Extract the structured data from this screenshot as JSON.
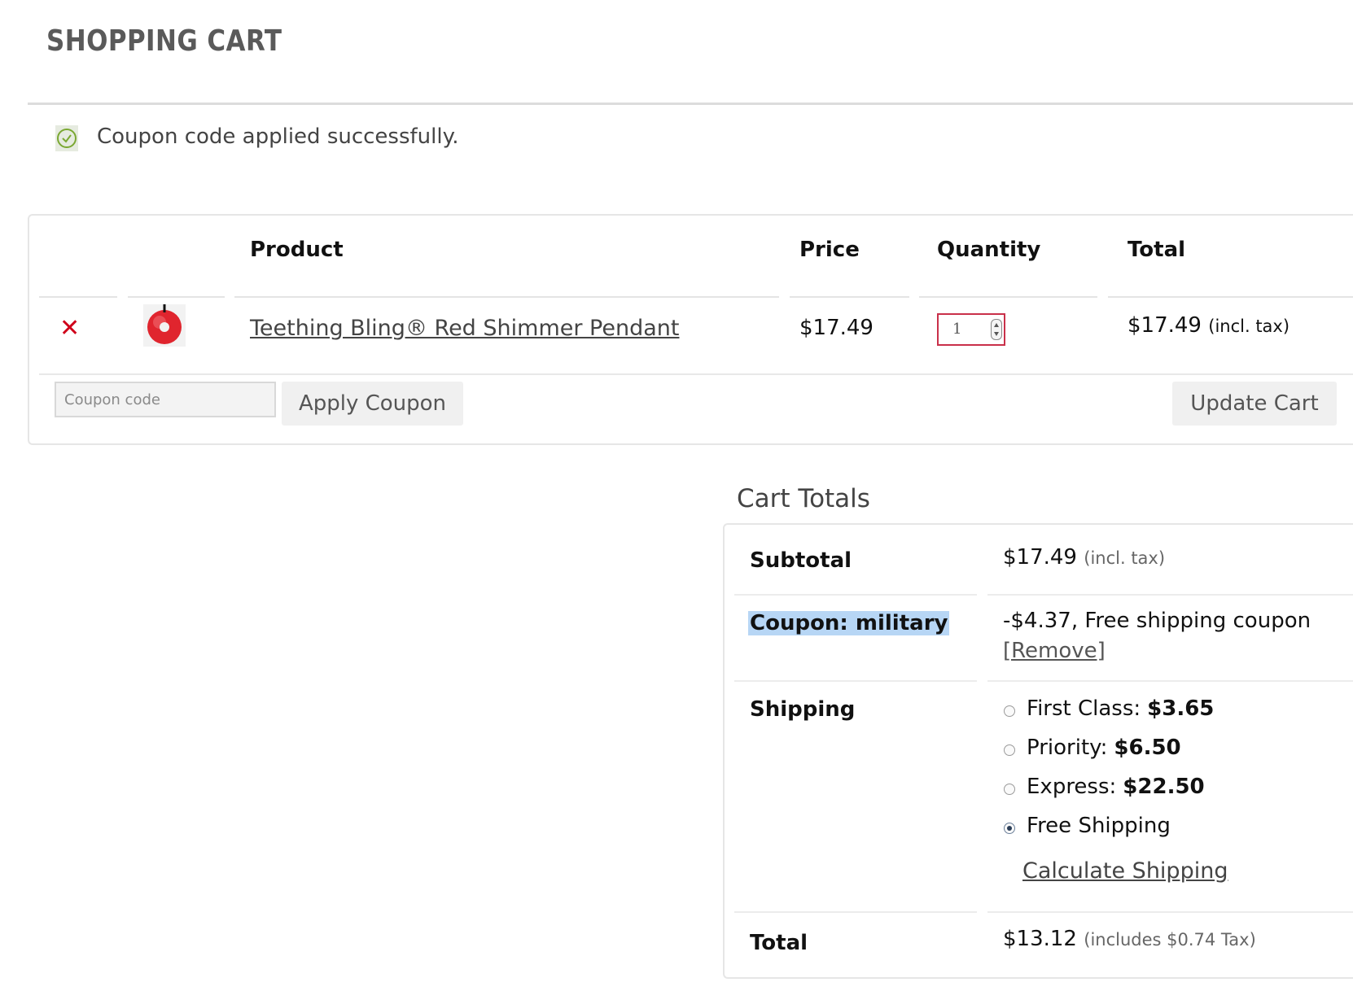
{
  "page": {
    "title": "SHOPPING CART"
  },
  "notice": {
    "icon": "check-circle-icon",
    "text": "Coupon code applied successfully."
  },
  "cart": {
    "columns": {
      "product": "Product",
      "price": "Price",
      "quantity": "Quantity",
      "total": "Total"
    },
    "items": [
      {
        "remove_icon": "close-icon",
        "remove_glyph": "✕",
        "thumbnail": "red-pendant-thumbnail",
        "name": "Teething Bling® Red Shimmer Pendant",
        "price": "$17.49",
        "quantity": "1",
        "total": "$17.49",
        "total_note": "(incl. tax)"
      }
    ],
    "coupon_placeholder": "Coupon code",
    "apply_coupon_label": "Apply Coupon",
    "update_cart_label": "Update Cart"
  },
  "totals": {
    "title": "Cart Totals",
    "subtotal_label": "Subtotal",
    "subtotal_value": "$17.49",
    "subtotal_note": "(incl. tax)",
    "coupon_label": "Coupon: military",
    "coupon_value": "-$4.37, Free shipping coupon",
    "coupon_remove": "[Remove]",
    "shipping_label": "Shipping",
    "shipping_options": [
      {
        "name": "First Class:",
        "price": "$3.65",
        "selected": false
      },
      {
        "name": "Priority:",
        "price": "$6.50",
        "selected": false
      },
      {
        "name": "Express:",
        "price": "$22.50",
        "selected": false
      },
      {
        "name": "Free Shipping",
        "price": "",
        "selected": true
      }
    ],
    "calculate_shipping": "Calculate Shipping",
    "total_label": "Total",
    "total_value": "$13.12",
    "total_note": "(includes $0.74 Tax)"
  },
  "colors": {
    "remove": "#d0021b",
    "qty_border": "#c9304a",
    "coupon_highlight": "#b7d6f5",
    "success_icon": "#7aa832"
  }
}
